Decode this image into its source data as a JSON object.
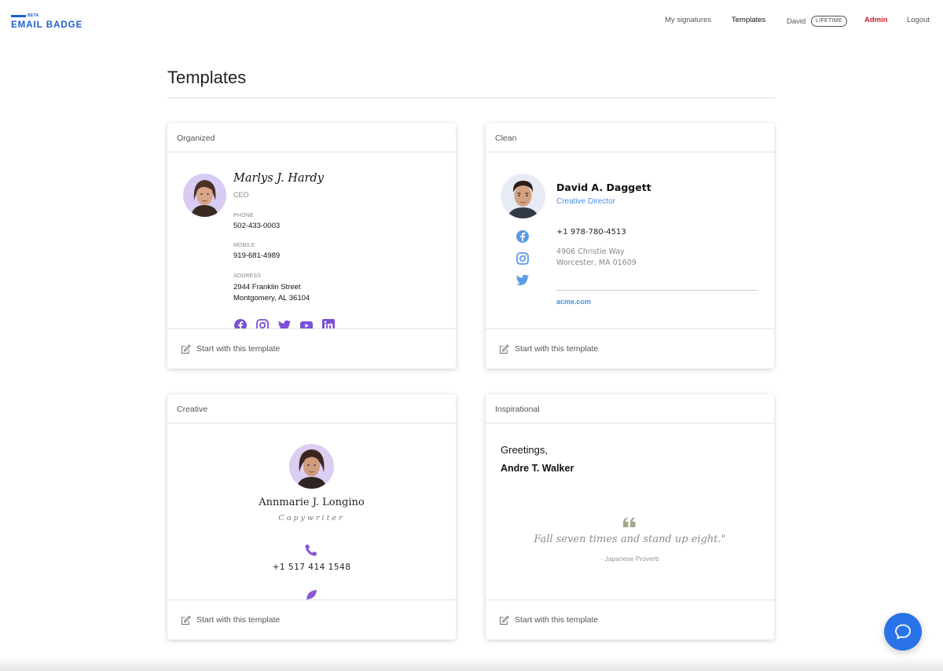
{
  "brand": {
    "beta": "BETA",
    "name": "EMAIL BADGE",
    "color": "#1d5fd1"
  },
  "nav": {
    "my_signatures": "My signatures",
    "templates": "Templates",
    "user": "David",
    "plan_badge": "LIFETIME",
    "admin": "Admin",
    "logout": "Logout"
  },
  "page": {
    "title": "Templates"
  },
  "cards": {
    "organized": {
      "title": "Organized",
      "name": "Marlys J. Hardy",
      "role": "CEO",
      "phone_label": "PHONE",
      "phone": "502-433-0003",
      "mobile_label": "MOBILE",
      "mobile": "919-681-4989",
      "address_label": "ADDRESS",
      "address_line1": "2944 Franklin Street",
      "address_line2": "Montgomery, AL 36104",
      "social_icons": [
        "facebook-icon",
        "instagram-icon",
        "twitter-icon",
        "youtube-icon",
        "linkedin-icon"
      ],
      "accent": "#7b4fd8",
      "cta": "Start with this template"
    },
    "clean": {
      "title": "Clean",
      "name": "David A. Daggett",
      "role": "Creative Director",
      "phone": "+1 978-780-4513",
      "address_line1": "4906 Christie Way",
      "address_line2": "Worcester, MA 01609",
      "website": "acme.com",
      "social_icons": [
        "facebook-icon",
        "instagram-icon",
        "twitter-icon"
      ],
      "accent": "#4a90e2",
      "cta": "Start with this template"
    },
    "creative": {
      "title": "Creative",
      "name": "Annmarie J. Longino",
      "role": "Copywriter",
      "phone": "+1 517 414 1548",
      "icons": [
        "phone-icon",
        "feather-icon"
      ],
      "accent": "#8a55d6",
      "cta": "Start with this template"
    },
    "inspirational": {
      "title": "Inspirational",
      "greeting": "Greetings,",
      "name": "Andre T. Walker",
      "quote": "Fall seven times and stand up eight.\"",
      "source": "- Japanese Proverb",
      "cta": "Start with this template"
    }
  },
  "chat": {
    "icon": "chat-bubble-icon",
    "color": "#2a72e8"
  }
}
